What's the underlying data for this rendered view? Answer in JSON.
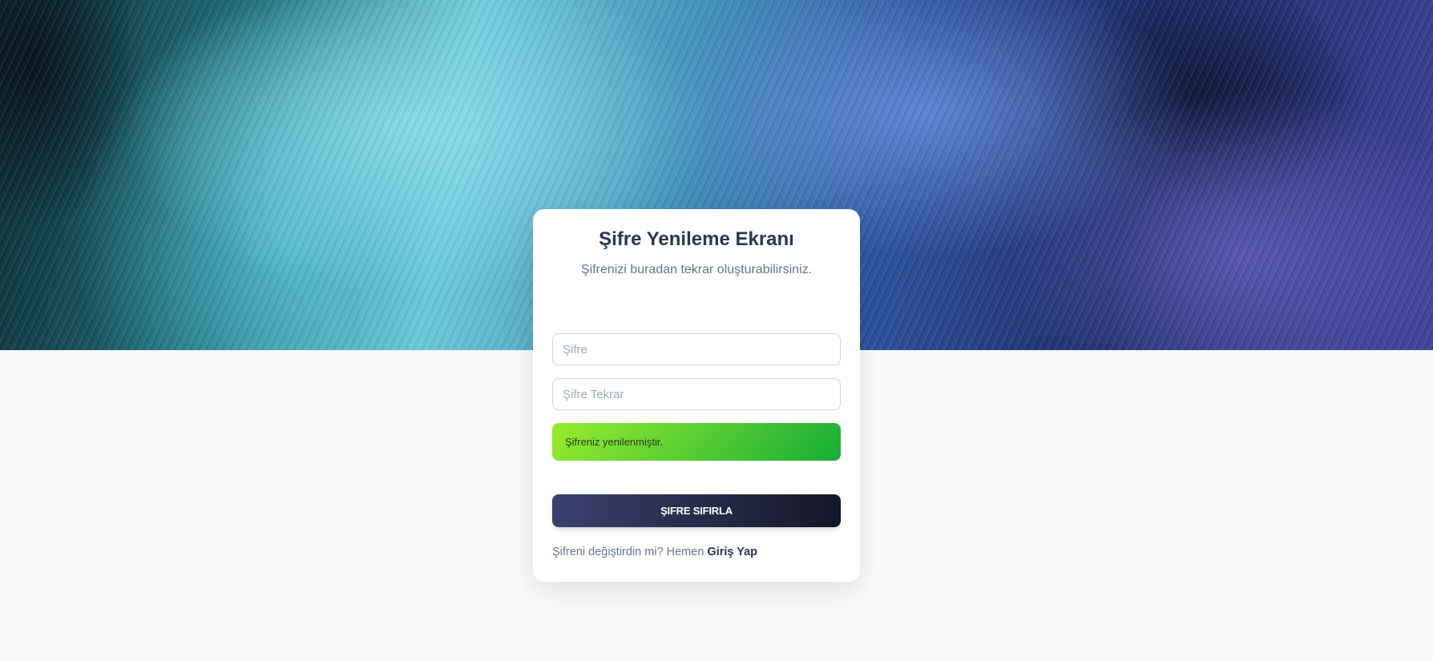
{
  "hero": {
    "image": "abstract-flowing-lines-background"
  },
  "card": {
    "title": "Şifre Yenileme Ekranı",
    "subtitle": "Şifrenizi buradan tekrar oluşturabilirsiniz.",
    "password": {
      "placeholder": "Şifre",
      "value": ""
    },
    "password_repeat": {
      "placeholder": "Şifre Tekrar",
      "value": ""
    },
    "alert": {
      "message": "Şifreniz yenilenmiştir.",
      "color": "#17ad37"
    },
    "submit_label": "ŞIFRE SIFIRLA",
    "footer": {
      "prompt": "Şifreni değiştirdin mi? Hemen ",
      "link_label": "Giriş Yap"
    }
  },
  "colors": {
    "page_background": "#f8f9fa",
    "button_dark": "#141727",
    "title": "#2c3654"
  }
}
